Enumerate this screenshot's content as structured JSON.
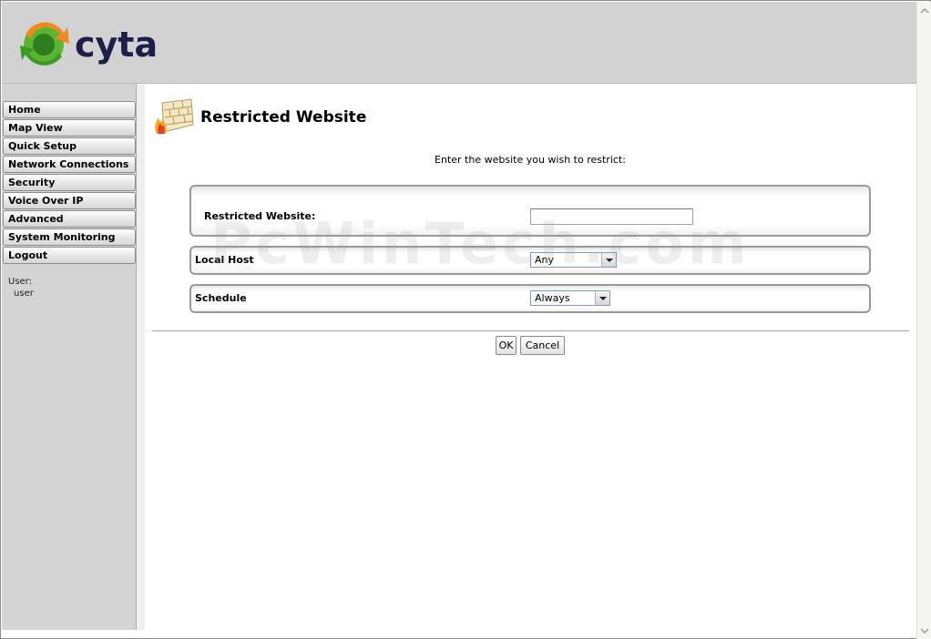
{
  "brand": {
    "name": "cyta"
  },
  "sidebar": {
    "items": [
      {
        "label": "Home"
      },
      {
        "label": "Map View"
      },
      {
        "label": "Quick Setup"
      },
      {
        "label": "Network Connections"
      },
      {
        "label": "Security"
      },
      {
        "label": "Voice Over IP"
      },
      {
        "label": "Advanced"
      },
      {
        "label": "System Monitoring"
      },
      {
        "label": "Logout"
      }
    ],
    "user_label": "User:",
    "user_name": "user"
  },
  "page": {
    "title": "Restricted Website",
    "instruction": "Enter the website you wish to restrict:"
  },
  "form": {
    "website_label": "Restricted Website:",
    "website_value": "",
    "local_host_label": "Local Host",
    "local_host_selected": "Any",
    "schedule_label": "Schedule",
    "schedule_selected": "Always"
  },
  "buttons": {
    "ok": "OK",
    "cancel": "Cancel"
  },
  "watermark": "PcWinTech.com",
  "colors": {
    "brand_text": "#1d1f4a",
    "logo_green": "#5bb531",
    "logo_orange": "#f08a1e"
  }
}
